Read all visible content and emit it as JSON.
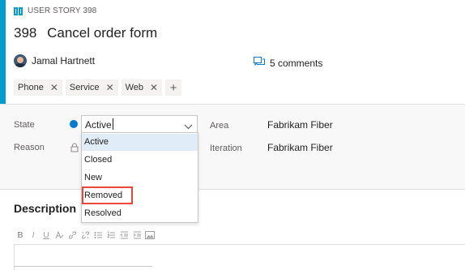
{
  "work_item": {
    "type_label": "USER STORY 398",
    "id": "398",
    "title": "Cancel order form",
    "accent_color": "#009ccc"
  },
  "assignee": {
    "name": "Jamal Hartnett"
  },
  "comments": {
    "label": "5 comments"
  },
  "tags": [
    {
      "label": "Phone"
    },
    {
      "label": "Service"
    },
    {
      "label": "Web"
    }
  ],
  "fields": {
    "state_label": "State",
    "state_value": "Active",
    "state_color": "#007acc",
    "reason_label": "Reason",
    "area_label": "Area",
    "area_value": "Fabrikam Fiber",
    "iteration_label": "Iteration",
    "iteration_value": "Fabrikam Fiber"
  },
  "state_dropdown": {
    "options": [
      "Active",
      "Closed",
      "New",
      "Removed",
      "Resolved"
    ],
    "selected": "Active",
    "highlighted": "Removed",
    "highlight_color": "#e8483a"
  },
  "description": {
    "title": "Description",
    "toolbar_icons": [
      "bold-icon",
      "italic-icon",
      "underline-icon",
      "highlight-icon",
      "link-icon",
      "unlink-icon",
      "bulleted-list-icon",
      "numbered-list-icon",
      "decrease-indent-icon",
      "increase-indent-icon",
      "image-icon"
    ]
  }
}
